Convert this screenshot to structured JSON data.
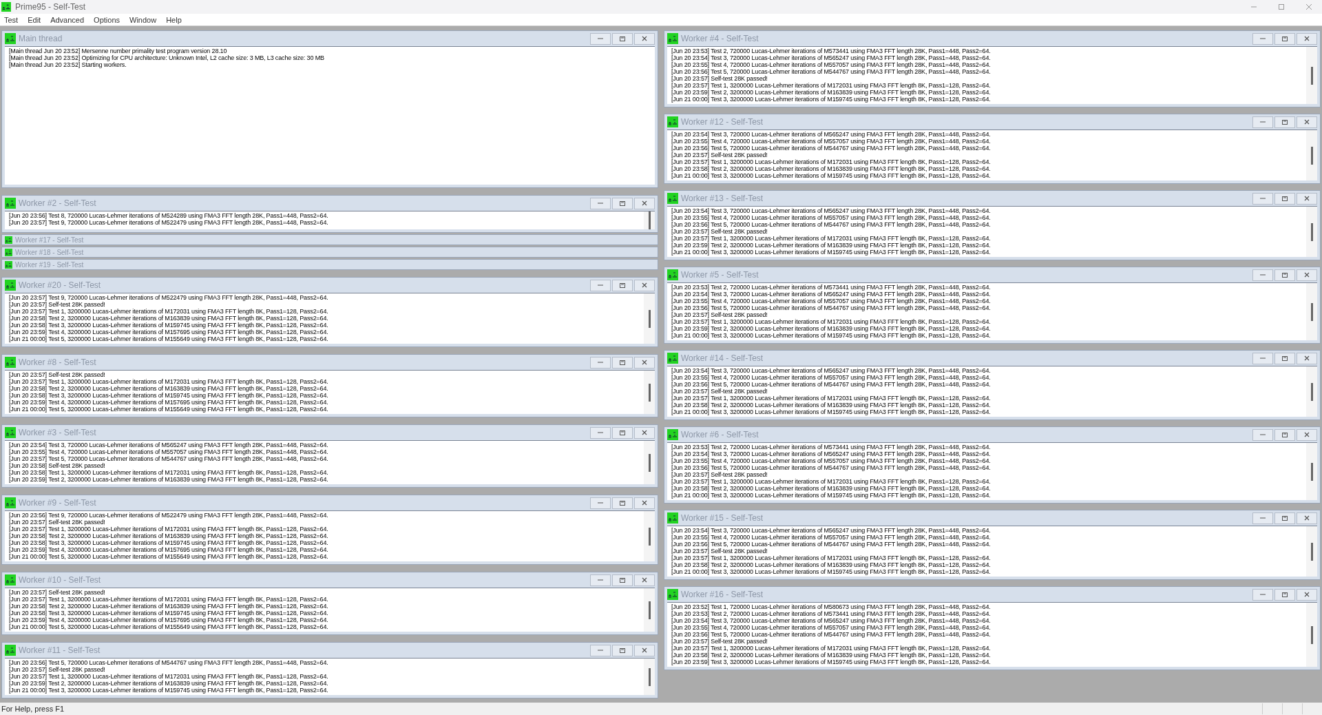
{
  "window": {
    "title": "Prime95 - Self-Test"
  },
  "menu": [
    "Test",
    "Edit",
    "Advanced",
    "Options",
    "Window",
    "Help"
  ],
  "columns": [
    {
      "windows": [
        {
          "title": "Main thread",
          "kind": "full",
          "lines": [
            "[Main thread Jun 20 23:52] Mersenne number primality test program version 28.10",
            "[Main thread Jun 20 23:52] Optimizing for CPU architecture: Unknown Intel, L2 cache size: 3 MB, L3 cache size: 30 MB",
            "[Main thread Jun 20 23:52] Starting workers."
          ]
        },
        {
          "title": "Worker #2 - Self-Test",
          "kind": "log",
          "lines": [
            "[Jun 20 23:56] Test 8, 720000 Lucas-Lehmer iterations of M524289 using FMA3 FFT length 28K, Pass1=448, Pass2=64.",
            "[Jun 20 23:57] Test 9, 720000 Lucas-Lehmer iterations of M522479 using FMA3 FFT length 28K, Pass1=448, Pass2=64."
          ]
        },
        {
          "title": "Worker #17 - Self-Test",
          "kind": "collapsed"
        },
        {
          "title": "Worker #18 - Self-Test",
          "kind": "collapsed"
        },
        {
          "title": "Worker #19 - Self-Test",
          "kind": "collapsed"
        },
        {
          "title": "Worker #20 - Self-Test",
          "kind": "log",
          "lines": [
            "[Jun 20 23:57] Test 9, 720000 Lucas-Lehmer iterations of M522479 using FMA3 FFT length 28K, Pass1=448, Pass2=64.",
            "[Jun 20 23:57] Self-test 28K passed!",
            "[Jun 20 23:57] Test 1, 3200000 Lucas-Lehmer iterations of M172031 using FMA3 FFT length 8K, Pass1=128, Pass2=64.",
            "[Jun 20 23:58] Test 2, 3200000 Lucas-Lehmer iterations of M163839 using FMA3 FFT length 8K, Pass1=128, Pass2=64.",
            "[Jun 20 23:58] Test 3, 3200000 Lucas-Lehmer iterations of M159745 using FMA3 FFT length 8K, Pass1=128, Pass2=64.",
            "[Jun 20 23:59] Test 4, 3200000 Lucas-Lehmer iterations of M157695 using FMA3 FFT length 8K, Pass1=128, Pass2=64.",
            "[Jun 21 00:00] Test 5, 3200000 Lucas-Lehmer iterations of M155649 using FMA3 FFT length 8K, Pass1=128, Pass2=64."
          ]
        },
        {
          "title": "Worker #8 - Self-Test",
          "kind": "log",
          "lines": [
            "[Jun 20 23:57] Self-test 28K passed!",
            "[Jun 20 23:57] Test 1, 3200000 Lucas-Lehmer iterations of M172031 using FMA3 FFT length 8K, Pass1=128, Pass2=64.",
            "[Jun 20 23:58] Test 2, 3200000 Lucas-Lehmer iterations of M163839 using FMA3 FFT length 8K, Pass1=128, Pass2=64.",
            "[Jun 20 23:58] Test 3, 3200000 Lucas-Lehmer iterations of M159745 using FMA3 FFT length 8K, Pass1=128, Pass2=64.",
            "[Jun 20 23:59] Test 4, 3200000 Lucas-Lehmer iterations of M157695 using FMA3 FFT length 8K, Pass1=128, Pass2=64.",
            "[Jun 21 00:00] Test 5, 3200000 Lucas-Lehmer iterations of M155649 using FMA3 FFT length 8K, Pass1=128, Pass2=64."
          ]
        },
        {
          "title": "Worker #3 - Self-Test",
          "kind": "log",
          "lines": [
            "[Jun 20 23:54] Test 3, 720000 Lucas-Lehmer iterations of M565247 using FMA3 FFT length 28K, Pass1=448, Pass2=64.",
            "[Jun 20 23:55] Test 4, 720000 Lucas-Lehmer iterations of M557057 using FMA3 FFT length 28K, Pass1=448, Pass2=64.",
            "[Jun 20 23:57] Test 5, 720000 Lucas-Lehmer iterations of M544767 using FMA3 FFT length 28K, Pass1=448, Pass2=64.",
            "[Jun 20 23:58] Self-test 28K passed!",
            "[Jun 20 23:58] Test 1, 3200000 Lucas-Lehmer iterations of M172031 using FMA3 FFT length 8K, Pass1=128, Pass2=64.",
            "[Jun 20 23:59] Test 2, 3200000 Lucas-Lehmer iterations of M163839 using FMA3 FFT length 8K, Pass1=128, Pass2=64."
          ]
        },
        {
          "title": "Worker #9 - Self-Test",
          "kind": "log",
          "lines": [
            "[Jun 20 23:56] Test 9, 720000 Lucas-Lehmer iterations of M522479 using FMA3 FFT length 28K, Pass1=448, Pass2=64.",
            "[Jun 20 23:57] Self-test 28K passed!",
            "[Jun 20 23:57] Test 1, 3200000 Lucas-Lehmer iterations of M172031 using FMA3 FFT length 8K, Pass1=128, Pass2=64.",
            "[Jun 20 23:58] Test 2, 3200000 Lucas-Lehmer iterations of M163839 using FMA3 FFT length 8K, Pass1=128, Pass2=64.",
            "[Jun 20 23:58] Test 3, 3200000 Lucas-Lehmer iterations of M159745 using FMA3 FFT length 8K, Pass1=128, Pass2=64.",
            "[Jun 20 23:59] Test 4, 3200000 Lucas-Lehmer iterations of M157695 using FMA3 FFT length 8K, Pass1=128, Pass2=64.",
            "[Jun 21 00:00] Test 5, 3200000 Lucas-Lehmer iterations of M155649 using FMA3 FFT length 8K, Pass1=128, Pass2=64."
          ]
        },
        {
          "title": "Worker #10 - Self-Test",
          "kind": "log",
          "lines": [
            "[Jun 20 23:57] Self-test 28K passed!",
            "[Jun 20 23:57] Test 1, 3200000 Lucas-Lehmer iterations of M172031 using FMA3 FFT length 8K, Pass1=128, Pass2=64.",
            "[Jun 20 23:58] Test 2, 3200000 Lucas-Lehmer iterations of M163839 using FMA3 FFT length 8K, Pass1=128, Pass2=64.",
            "[Jun 20 23:58] Test 3, 3200000 Lucas-Lehmer iterations of M159745 using FMA3 FFT length 8K, Pass1=128, Pass2=64.",
            "[Jun 20 23:59] Test 4, 3200000 Lucas-Lehmer iterations of M157695 using FMA3 FFT length 8K, Pass1=128, Pass2=64.",
            "[Jun 21 00:00] Test 5, 3200000 Lucas-Lehmer iterations of M155649 using FMA3 FFT length 8K, Pass1=128, Pass2=64."
          ]
        },
        {
          "title": "Worker #11 - Self-Test",
          "kind": "log",
          "lines": [
            "[Jun 20 23:56] Test 5, 720000 Lucas-Lehmer iterations of M544767 using FMA3 FFT length 28K, Pass1=448, Pass2=64.",
            "[Jun 20 23:57] Self-test 28K passed!",
            "[Jun 20 23:57] Test 1, 3200000 Lucas-Lehmer iterations of M172031 using FMA3 FFT length 8K, Pass1=128, Pass2=64.",
            "[Jun 20 23:59] Test 2, 3200000 Lucas-Lehmer iterations of M163839 using FMA3 FFT length 8K, Pass1=128, Pass2=64.",
            "[Jun 21 00:00] Test 3, 3200000 Lucas-Lehmer iterations of M159745 using FMA3 FFT length 8K, Pass1=128, Pass2=64."
          ]
        }
      ]
    },
    {
      "windows": [
        {
          "title": "Worker #4 - Self-Test",
          "kind": "log",
          "lines": [
            "[Jun 20 23:53] Test 2, 720000 Lucas-Lehmer iterations of M573441 using FMA3 FFT length 28K, Pass1=448, Pass2=64.",
            "[Jun 20 23:54] Test 3, 720000 Lucas-Lehmer iterations of M565247 using FMA3 FFT length 28K, Pass1=448, Pass2=64.",
            "[Jun 20 23:55] Test 4, 720000 Lucas-Lehmer iterations of M557057 using FMA3 FFT length 28K, Pass1=448, Pass2=64.",
            "[Jun 20 23:56] Test 5, 720000 Lucas-Lehmer iterations of M544767 using FMA3 FFT length 28K, Pass1=448, Pass2=64.",
            "[Jun 20 23:57] Self-test 28K passed!",
            "[Jun 20 23:57] Test 1, 3200000 Lucas-Lehmer iterations of M172031 using FMA3 FFT length 8K, Pass1=128, Pass2=64.",
            "[Jun 20 23:59] Test 2, 3200000 Lucas-Lehmer iterations of M163839 using FMA3 FFT length 8K, Pass1=128, Pass2=64.",
            "[Jun 21 00:00] Test 3, 3200000 Lucas-Lehmer iterations of M159745 using FMA3 FFT length 8K, Pass1=128, Pass2=64."
          ]
        },
        {
          "title": "Worker #12 - Self-Test",
          "kind": "log",
          "lines": [
            "[Jun 20 23:54] Test 3, 720000 Lucas-Lehmer iterations of M565247 using FMA3 FFT length 28K, Pass1=448, Pass2=64.",
            "[Jun 20 23:55] Test 4, 720000 Lucas-Lehmer iterations of M557057 using FMA3 FFT length 28K, Pass1=448, Pass2=64.",
            "[Jun 20 23:56] Test 5, 720000 Lucas-Lehmer iterations of M544767 using FMA3 FFT length 28K, Pass1=448, Pass2=64.",
            "[Jun 20 23:57] Self-test 28K passed!",
            "[Jun 20 23:57] Test 1, 3200000 Lucas-Lehmer iterations of M172031 using FMA3 FFT length 8K, Pass1=128, Pass2=64.",
            "[Jun 20 23:58] Test 2, 3200000 Lucas-Lehmer iterations of M163839 using FMA3 FFT length 8K, Pass1=128, Pass2=64.",
            "[Jun 21 00:00] Test 3, 3200000 Lucas-Lehmer iterations of M159745 using FMA3 FFT length 8K, Pass1=128, Pass2=64."
          ]
        },
        {
          "title": "Worker #13 - Self-Test",
          "kind": "log",
          "lines": [
            "[Jun 20 23:54] Test 3, 720000 Lucas-Lehmer iterations of M565247 using FMA3 FFT length 28K, Pass1=448, Pass2=64.",
            "[Jun 20 23:55] Test 4, 720000 Lucas-Lehmer iterations of M557057 using FMA3 FFT length 28K, Pass1=448, Pass2=64.",
            "[Jun 20 23:56] Test 5, 720000 Lucas-Lehmer iterations of M544767 using FMA3 FFT length 28K, Pass1=448, Pass2=64.",
            "[Jun 20 23:57] Self-test 28K passed!",
            "[Jun 20 23:57] Test 1, 3200000 Lucas-Lehmer iterations of M172031 using FMA3 FFT length 8K, Pass1=128, Pass2=64.",
            "[Jun 20 23:59] Test 2, 3200000 Lucas-Lehmer iterations of M163839 using FMA3 FFT length 8K, Pass1=128, Pass2=64.",
            "[Jun 21 00:00] Test 3, 3200000 Lucas-Lehmer iterations of M159745 using FMA3 FFT length 8K, Pass1=128, Pass2=64."
          ]
        },
        {
          "title": "Worker #5 - Self-Test",
          "kind": "log",
          "lines": [
            "[Jun 20 23:53] Test 2, 720000 Lucas-Lehmer iterations of M573441 using FMA3 FFT length 28K, Pass1=448, Pass2=64.",
            "[Jun 20 23:54] Test 3, 720000 Lucas-Lehmer iterations of M565247 using FMA3 FFT length 28K, Pass1=448, Pass2=64.",
            "[Jun 20 23:55] Test 4, 720000 Lucas-Lehmer iterations of M557057 using FMA3 FFT length 28K, Pass1=448, Pass2=64.",
            "[Jun 20 23:56] Test 5, 720000 Lucas-Lehmer iterations of M544767 using FMA3 FFT length 28K, Pass1=448, Pass2=64.",
            "[Jun 20 23:57] Self-test 28K passed!",
            "[Jun 20 23:57] Test 1, 3200000 Lucas-Lehmer iterations of M172031 using FMA3 FFT length 8K, Pass1=128, Pass2=64.",
            "[Jun 20 23:59] Test 2, 3200000 Lucas-Lehmer iterations of M163839 using FMA3 FFT length 8K, Pass1=128, Pass2=64.",
            "[Jun 21 00:00] Test 3, 3200000 Lucas-Lehmer iterations of M159745 using FMA3 FFT length 8K, Pass1=128, Pass2=64."
          ]
        },
        {
          "title": "Worker #14 - Self-Test",
          "kind": "log",
          "lines": [
            "[Jun 20 23:54] Test 3, 720000 Lucas-Lehmer iterations of M565247 using FMA3 FFT length 28K, Pass1=448, Pass2=64.",
            "[Jun 20 23:55] Test 4, 720000 Lucas-Lehmer iterations of M557057 using FMA3 FFT length 28K, Pass1=448, Pass2=64.",
            "[Jun 20 23:56] Test 5, 720000 Lucas-Lehmer iterations of M544767 using FMA3 FFT length 28K, Pass1=448, Pass2=64.",
            "[Jun 20 23:57] Self-test 28K passed!",
            "[Jun 20 23:57] Test 1, 3200000 Lucas-Lehmer iterations of M172031 using FMA3 FFT length 8K, Pass1=128, Pass2=64.",
            "[Jun 20 23:58] Test 2, 3200000 Lucas-Lehmer iterations of M163839 using FMA3 FFT length 8K, Pass1=128, Pass2=64.",
            "[Jun 21 00:00] Test 3, 3200000 Lucas-Lehmer iterations of M159745 using FMA3 FFT length 8K, Pass1=128, Pass2=64."
          ]
        },
        {
          "title": "Worker #6 - Self-Test",
          "kind": "log",
          "lines": [
            "[Jun 20 23:53] Test 2, 720000 Lucas-Lehmer iterations of M573441 using FMA3 FFT length 28K, Pass1=448, Pass2=64.",
            "[Jun 20 23:54] Test 3, 720000 Lucas-Lehmer iterations of M565247 using FMA3 FFT length 28K, Pass1=448, Pass2=64.",
            "[Jun 20 23:55] Test 4, 720000 Lucas-Lehmer iterations of M557057 using FMA3 FFT length 28K, Pass1=448, Pass2=64.",
            "[Jun 20 23:56] Test 5, 720000 Lucas-Lehmer iterations of M544767 using FMA3 FFT length 28K, Pass1=448, Pass2=64.",
            "[Jun 20 23:57] Self-test 28K passed!",
            "[Jun 20 23:57] Test 1, 3200000 Lucas-Lehmer iterations of M172031 using FMA3 FFT length 8K, Pass1=128, Pass2=64.",
            "[Jun 20 23:58] Test 2, 3200000 Lucas-Lehmer iterations of M163839 using FMA3 FFT length 8K, Pass1=128, Pass2=64.",
            "[Jun 21 00:00] Test 3, 3200000 Lucas-Lehmer iterations of M159745 using FMA3 FFT length 8K, Pass1=128, Pass2=64."
          ]
        },
        {
          "title": "Worker #15 - Self-Test",
          "kind": "log",
          "lines": [
            "[Jun 20 23:54] Test 3, 720000 Lucas-Lehmer iterations of M565247 using FMA3 FFT length 28K, Pass1=448, Pass2=64.",
            "[Jun 20 23:55] Test 4, 720000 Lucas-Lehmer iterations of M557057 using FMA3 FFT length 28K, Pass1=448, Pass2=64.",
            "[Jun 20 23:56] Test 5, 720000 Lucas-Lehmer iterations of M544767 using FMA3 FFT length 28K, Pass1=448, Pass2=64.",
            "[Jun 20 23:57] Self-test 28K passed!",
            "[Jun 20 23:57] Test 1, 3200000 Lucas-Lehmer iterations of M172031 using FMA3 FFT length 8K, Pass1=128, Pass2=64.",
            "[Jun 20 23:58] Test 2, 3200000 Lucas-Lehmer iterations of M163839 using FMA3 FFT length 8K, Pass1=128, Pass2=64.",
            "[Jun 21 00:00] Test 3, 3200000 Lucas-Lehmer iterations of M159745 using FMA3 FFT length 8K, Pass1=128, Pass2=64."
          ]
        },
        {
          "title": "Worker #16 - Self-Test",
          "kind": "log",
          "lines": [
            "[Jun 20 23:52] Test 1, 720000 Lucas-Lehmer iterations of M580673 using FMA3 FFT length 28K, Pass1=448, Pass2=64.",
            "[Jun 20 23:53] Test 2, 720000 Lucas-Lehmer iterations of M573441 using FMA3 FFT length 28K, Pass1=448, Pass2=64.",
            "[Jun 20 23:54] Test 3, 720000 Lucas-Lehmer iterations of M565247 using FMA3 FFT length 28K, Pass1=448, Pass2=64.",
            "[Jun 20 23:55] Test 4, 720000 Lucas-Lehmer iterations of M557057 using FMA3 FFT length 28K, Pass1=448, Pass2=64.",
            "[Jun 20 23:56] Test 5, 720000 Lucas-Lehmer iterations of M544767 using FMA3 FFT length 28K, Pass1=448, Pass2=64.",
            "[Jun 20 23:57] Self-test 28K passed!",
            "[Jun 20 23:57] Test 1, 3200000 Lucas-Lehmer iterations of M172031 using FMA3 FFT length 8K, Pass1=128, Pass2=64.",
            "[Jun 20 23:58] Test 2, 3200000 Lucas-Lehmer iterations of M163839 using FMA3 FFT length 8K, Pass1=128, Pass2=64.",
            "[Jun 20 23:59] Test 3, 3200000 Lucas-Lehmer iterations of M159745 using FMA3 FFT length 8K, Pass1=128, Pass2=64."
          ]
        }
      ]
    }
  ],
  "status_bar": "For Help, press F1"
}
